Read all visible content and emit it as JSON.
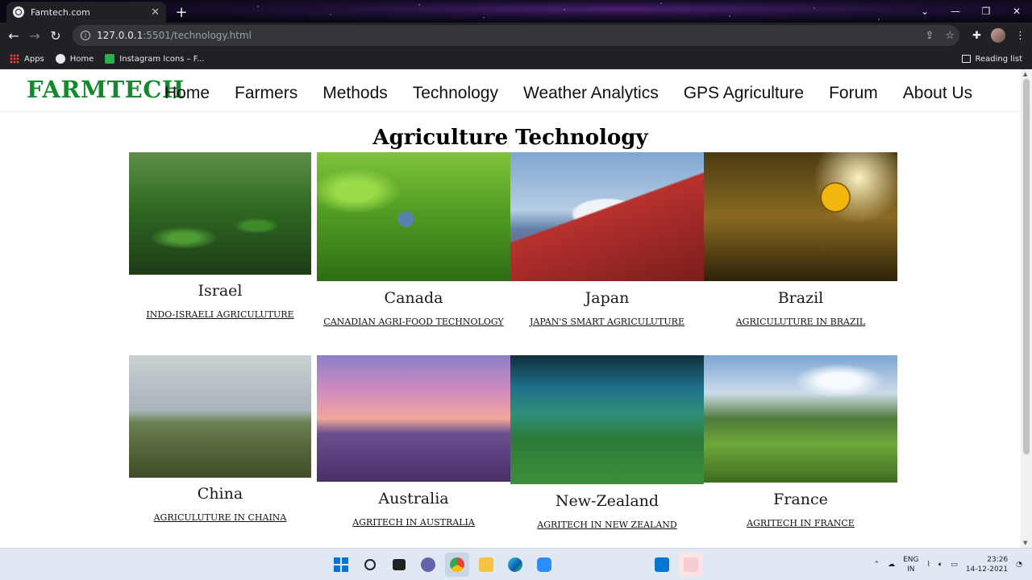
{
  "browser": {
    "tab_title": "Famtech.com",
    "tab_close": "✕",
    "new_tab": "+",
    "url_host": "127.0.0.1",
    "url_rest": ":5501/technology.html",
    "bookmarks": [
      "Apps",
      "Home",
      "Instagram Icons – F..."
    ],
    "reading_list": "Reading list",
    "win_controls": [
      "⌄",
      "—",
      "❐",
      "✕"
    ]
  },
  "site": {
    "logo": "FARMTECH",
    "menu": [
      "Home",
      "Farmers",
      "Methods",
      "Technology",
      "Weather Analytics",
      "GPS Agriculture",
      "Forum",
      "About Us"
    ],
    "page_title": "Agriculture Technology",
    "cards": [
      {
        "country": "Israel",
        "link": "INDO-ISRAELI AGRICULUTURE"
      },
      {
        "country": "Canada",
        "link": "CANADIAN AGRI-FOOD TECHNOLOGY"
      },
      {
        "country": "Japan",
        "link": "JAPAN'S SMART AGRICULUTURE"
      },
      {
        "country": "Brazil",
        "link": "AGRICULUTURE IN BRAZIL"
      },
      {
        "country": "China",
        "link": "AGRICULUTURE IN CHAINA"
      },
      {
        "country": "Australia",
        "link": "AGRITECH IN AUSTRALIA"
      },
      {
        "country": "New-Zealand",
        "link": "AGRITECH IN NEW ZEALAND"
      },
      {
        "country": "France",
        "link": "AGRITECH IN FRANCE"
      }
    ]
  },
  "taskbar": {
    "lang_top": "ENG",
    "lang_bottom": "IN",
    "time": "23:26",
    "date": "14-12-2021"
  }
}
